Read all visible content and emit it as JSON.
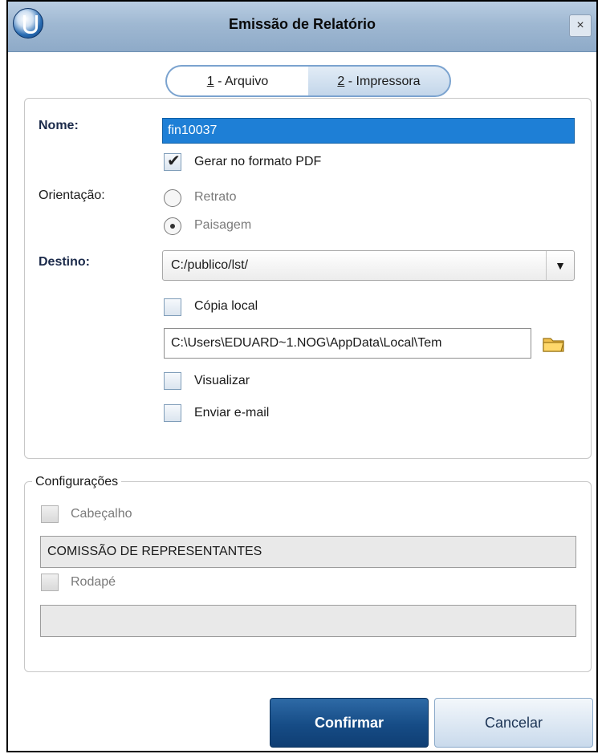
{
  "window": {
    "title": "Emissão de Relatório",
    "close_glyph": "×",
    "icon": "app-logo-icon"
  },
  "tabs": [
    {
      "mnemonic": "1",
      "label": " - Arquivo",
      "active": true
    },
    {
      "mnemonic": "2",
      "label": " - Impressora",
      "active": false
    }
  ],
  "form": {
    "name_label": "Nome:",
    "name_value": "fin10037",
    "pdf_checkbox": {
      "label": "Gerar no formato PDF",
      "checked": true
    },
    "orientation_label": "Orientação:",
    "orientation_options": [
      {
        "label": "Retrato",
        "selected": false
      },
      {
        "label": "Paisagem",
        "selected": true
      }
    ],
    "destination_label": "Destino:",
    "destination_value": "C:/publico/lst/",
    "local_copy": {
      "label": "Cópia local",
      "checked": false
    },
    "local_path": "C:\\Users\\EDUARD~1.NOG\\AppData\\Local\\Tem",
    "preview": {
      "label": "Visualizar",
      "checked": false
    },
    "send_email": {
      "label": "Enviar e-mail",
      "checked": false
    }
  },
  "settings": {
    "legend": "Configurações",
    "header": {
      "label": "Cabeçalho",
      "checked": false,
      "value": "COMISSÃO DE REPRESENTANTES"
    },
    "footer": {
      "label": "Rodapé",
      "checked": false,
      "value": ""
    }
  },
  "buttons": {
    "confirm": "Confirmar",
    "cancel": "Cancelar"
  },
  "colors": {
    "selection_blue": "#1e7fd6",
    "confirm_button": "#164c86",
    "titlebar": "#9fb8d2"
  }
}
